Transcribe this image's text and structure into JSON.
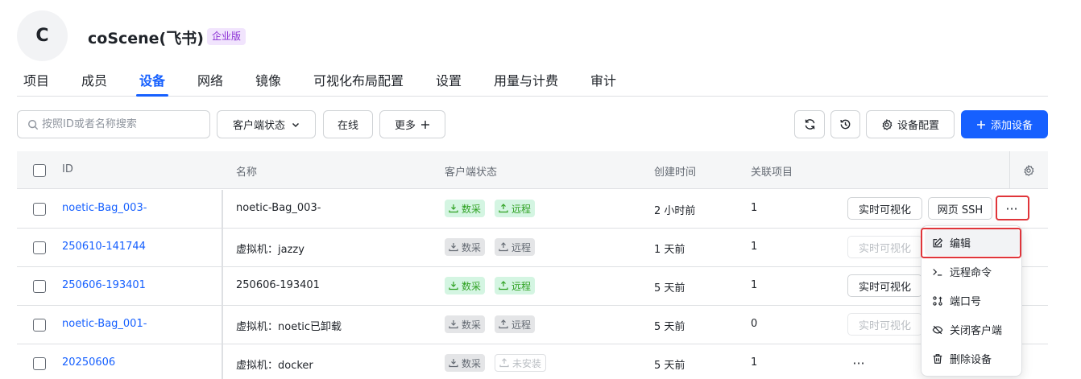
{
  "org": {
    "avatar_letter": "C",
    "name": "coScene(飞书)",
    "badge": "企业版"
  },
  "tabs": [
    {
      "label": "项目"
    },
    {
      "label": "成员"
    },
    {
      "label": "设备",
      "active": true
    },
    {
      "label": "网络"
    },
    {
      "label": "镜像"
    },
    {
      "label": "可视化布局配置"
    },
    {
      "label": "设置"
    },
    {
      "label": "用量与计费"
    },
    {
      "label": "审计"
    }
  ],
  "toolbar": {
    "search_placeholder": "按照ID或者名称搜索",
    "client_status_filter": "客户端状态",
    "online_filter": "在线",
    "more_filter": "更多",
    "device_config_label": "设备配置",
    "add_device_label": "添加设备"
  },
  "table": {
    "columns": [
      "ID",
      "名称",
      "客户端状态",
      "创建时间",
      "关联项目"
    ],
    "rows": [
      {
        "id": "noetic-Bag_003-",
        "name": "noetic-Bag_003-",
        "tag1": "数采",
        "tag2": "远程",
        "status": "active",
        "created": "2 小时前",
        "projects": "1"
      },
      {
        "id": "250610-141744",
        "name": "虚拟机：jazzy",
        "tag1": "数采",
        "tag2": "远程",
        "status": "inactive",
        "created": "1 天前",
        "projects": "1"
      },
      {
        "id": "250606-193401",
        "name": "250606-193401",
        "tag1": "数采",
        "tag2": "远程",
        "status": "active",
        "created": "5 天前",
        "projects": "1"
      },
      {
        "id": "noetic-Bag_001-",
        "name": "虚拟机：noetic已卸载",
        "tag1": "数采",
        "tag2": "远程",
        "status": "inactive",
        "created": "5 天前",
        "projects": "0"
      },
      {
        "id": "20250606",
        "name": "虚拟机：docker",
        "tag1": "数采",
        "tag2": "未安装",
        "status": "not-installed",
        "created": "5 天前",
        "projects": "1"
      }
    ],
    "action_visualize": "实时可视化",
    "action_ssh": "网页 SSH",
    "more_glyph": "···"
  },
  "menu": {
    "items": [
      {
        "label": "编辑",
        "icon": "edit-icon"
      },
      {
        "label": "远程命令",
        "icon": "terminal-icon"
      },
      {
        "label": "端口号",
        "icon": "port-icon"
      },
      {
        "label": "关闭客户端",
        "icon": "eye-off-icon"
      },
      {
        "label": "删除设备",
        "icon": "trash-icon"
      }
    ]
  },
  "colors": {
    "primary": "#1660ff",
    "success_tag_bg": "#d4f5e2",
    "success_tag_text": "#2ea121",
    "highlight": "#e0353a",
    "badge_bg": "#f1e4fd",
    "badge_text": "#8b2fd4"
  }
}
